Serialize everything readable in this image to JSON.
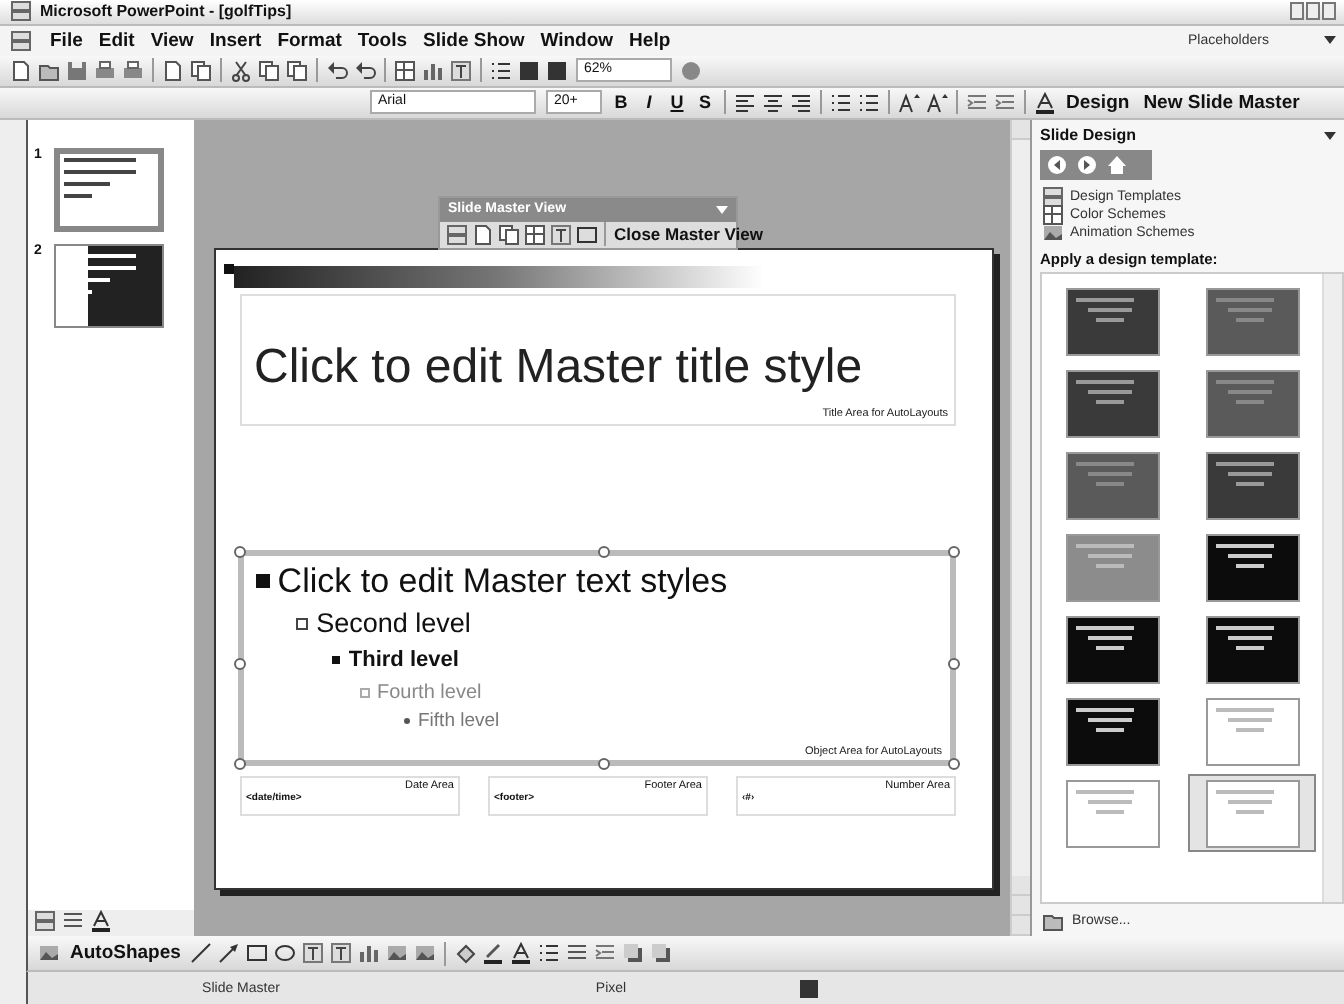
{
  "window": {
    "title": "Microsoft PowerPoint - [golfTips]"
  },
  "menu": [
    "File",
    "Edit",
    "View",
    "Insert",
    "Format",
    "Tools",
    "Slide Show",
    "Window",
    "Help"
  ],
  "help_box": {
    "value": "Placeholders"
  },
  "standard_toolbar": {
    "zoom": "62%"
  },
  "formatting_toolbar": {
    "font": "Arial",
    "font_size": "20+",
    "styles": [
      "B",
      "I",
      "U",
      "S"
    ],
    "design": "Design",
    "new_master": "New Slide Master"
  },
  "thumbnails": [
    {
      "number": "1",
      "kind": "light",
      "selected": true
    },
    {
      "number": "2",
      "kind": "dark",
      "selected": false
    }
  ],
  "master_toolbar": {
    "title": "Slide Master View",
    "close": "Close Master View"
  },
  "slide": {
    "title": "Click to edit Master title style",
    "title_area": "Title Area for AutoLayouts",
    "levels": [
      {
        "text": "Click to edit Master text styles",
        "kind": "square"
      },
      {
        "text": "Second level",
        "kind": "hollow"
      },
      {
        "text": "Third level",
        "kind": "square"
      },
      {
        "text": "Fourth level",
        "kind": "hollow"
      },
      {
        "text": "Fifth level",
        "kind": "dot"
      }
    ],
    "object_area": "Object Area for AutoLayouts",
    "footers": [
      {
        "label": "Date Area",
        "value": "<date/time>"
      },
      {
        "label": "Footer Area",
        "value": "<footer>"
      },
      {
        "label": "Number Area",
        "value": "‹#›"
      }
    ]
  },
  "task_pane": {
    "title": "Slide Design",
    "links": [
      "Design Templates",
      "Color Schemes",
      "Animation Schemes"
    ],
    "heading": "Apply a design template:",
    "templates": [
      {
        "kind": "dark",
        "selected": false
      },
      {
        "kind": "medium",
        "selected": false
      },
      {
        "kind": "dark",
        "selected": false
      },
      {
        "kind": "medium",
        "selected": false
      },
      {
        "kind": "medium",
        "selected": false
      },
      {
        "kind": "dark",
        "selected": false
      },
      {
        "kind": "light",
        "selected": false
      },
      {
        "kind": "black",
        "selected": false
      },
      {
        "kind": "black",
        "selected": false
      },
      {
        "kind": "black",
        "selected": false
      },
      {
        "kind": "black",
        "selected": false
      },
      {
        "kind": "white",
        "selected": false
      },
      {
        "kind": "white",
        "selected": false
      },
      {
        "kind": "white",
        "selected": true
      }
    ],
    "browse": "Browse..."
  },
  "drawing_toolbar": {
    "autoshapes": "AutoShapes"
  },
  "status_bar": [
    "Slide Master",
    "Pixel"
  ]
}
